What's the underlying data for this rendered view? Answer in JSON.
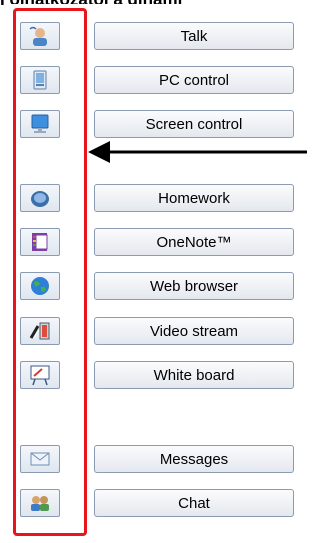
{
  "title_cut": "I olhatkozatoi a dinami",
  "rows": [
    {
      "label": "Talk",
      "icon": "talk-icon"
    },
    {
      "label": "PC control",
      "icon": "pc-control-icon"
    },
    {
      "label": "Screen control",
      "icon": "screen-control-icon"
    },
    {
      "label": "Homework",
      "icon": "homework-icon"
    },
    {
      "label": "OneNote™",
      "icon": "onenote-icon"
    },
    {
      "label": "Web browser",
      "icon": "web-browser-icon"
    },
    {
      "label": "Video stream",
      "icon": "video-stream-icon"
    },
    {
      "label": "White board",
      "icon": "white-board-icon"
    },
    {
      "label": "Messages",
      "icon": "messages-icon"
    },
    {
      "label": "Chat",
      "icon": "chat-icon"
    }
  ],
  "colors": {
    "highlight": "#e8161c",
    "arrow": "#000000"
  }
}
